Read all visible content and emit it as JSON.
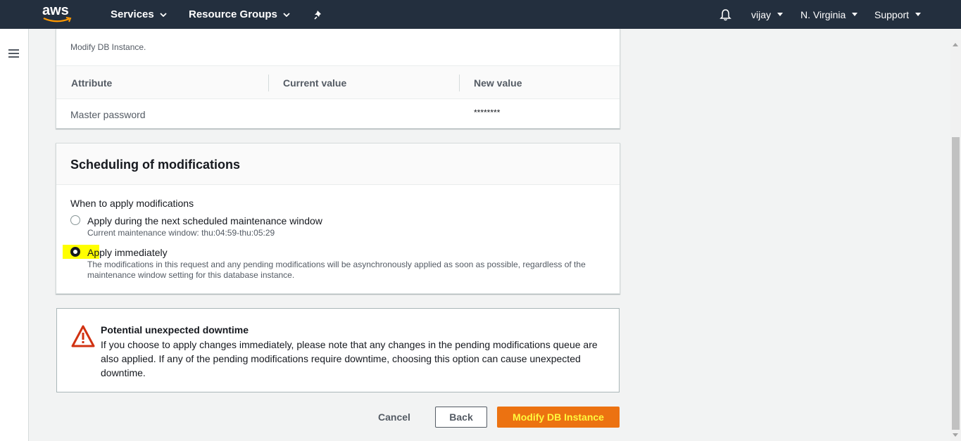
{
  "topnav": {
    "logo_text": "aws",
    "services_label": "Services",
    "resource_groups_label": "Resource Groups",
    "user_label": "vijay",
    "region_label": "N. Virginia",
    "support_label": "Support"
  },
  "attributes_panel": {
    "note_text": "Modify DB Instance.",
    "columns": [
      "Attribute",
      "Current value",
      "New value"
    ],
    "rows": [
      {
        "attribute": "Master password",
        "current": "",
        "new": "********"
      }
    ]
  },
  "scheduling": {
    "title": "Scheduling of modifications",
    "when_label": "When to apply modifications",
    "options": [
      {
        "label": "Apply during the next scheduled maintenance window",
        "description": "Current maintenance window: thu:04:59-thu:05:29",
        "selected": false
      },
      {
        "label": "Apply immediately",
        "description": "The modifications in this request and any pending modifications will be asynchronously applied as soon as possible, regardless of the maintenance window setting for this database instance.",
        "selected": true
      }
    ]
  },
  "warning": {
    "title": "Potential unexpected downtime",
    "body": "If you choose to apply changes immediately, please note that any changes in the pending modifications queue are also applied. If any of the pending modifications require downtime, choosing this option can cause unexpected downtime."
  },
  "actions": {
    "cancel_label": "Cancel",
    "back_label": "Back",
    "submit_label": "Modify DB Instance"
  },
  "colors": {
    "nav_bg": "#232f3e",
    "primary_button": "#ec7211",
    "warning_icon": "#d13212",
    "highlight": "#ffff00"
  }
}
